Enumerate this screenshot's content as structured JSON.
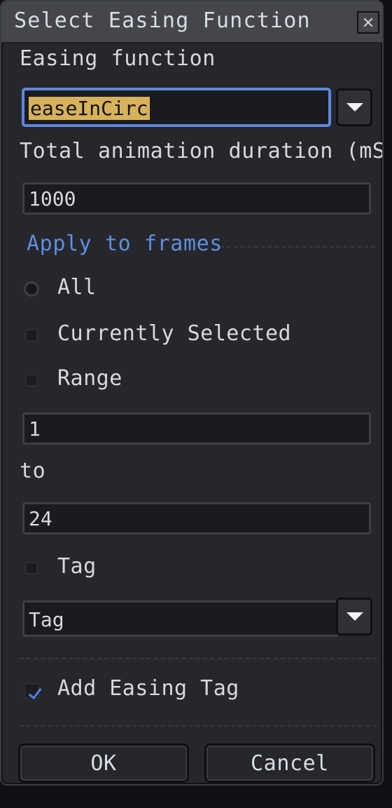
{
  "dialog": {
    "title": "Select Easing Function",
    "close_icon": "close-icon"
  },
  "easing": {
    "label": "Easing function",
    "selected": "easeInCirc"
  },
  "duration": {
    "label": "Total animation duration (mS)",
    "value": "1000"
  },
  "apply_to_frames": {
    "label": "Apply to frames",
    "options": [
      "All",
      "Currently Selected",
      "Range"
    ],
    "range_from": "1",
    "to_label": "to",
    "range_to": "24",
    "tag_option": "Tag",
    "tag_selected": "Tag"
  },
  "easing_tag": {
    "label": "Add Easing Tag",
    "checked": true
  },
  "buttons": {
    "ok": "OK",
    "cancel": "Cancel"
  },
  "colors": {
    "accent": "#5d88e0",
    "selection": "#d8b25a",
    "title_bar": "#45464b",
    "panel": "#26272c"
  }
}
